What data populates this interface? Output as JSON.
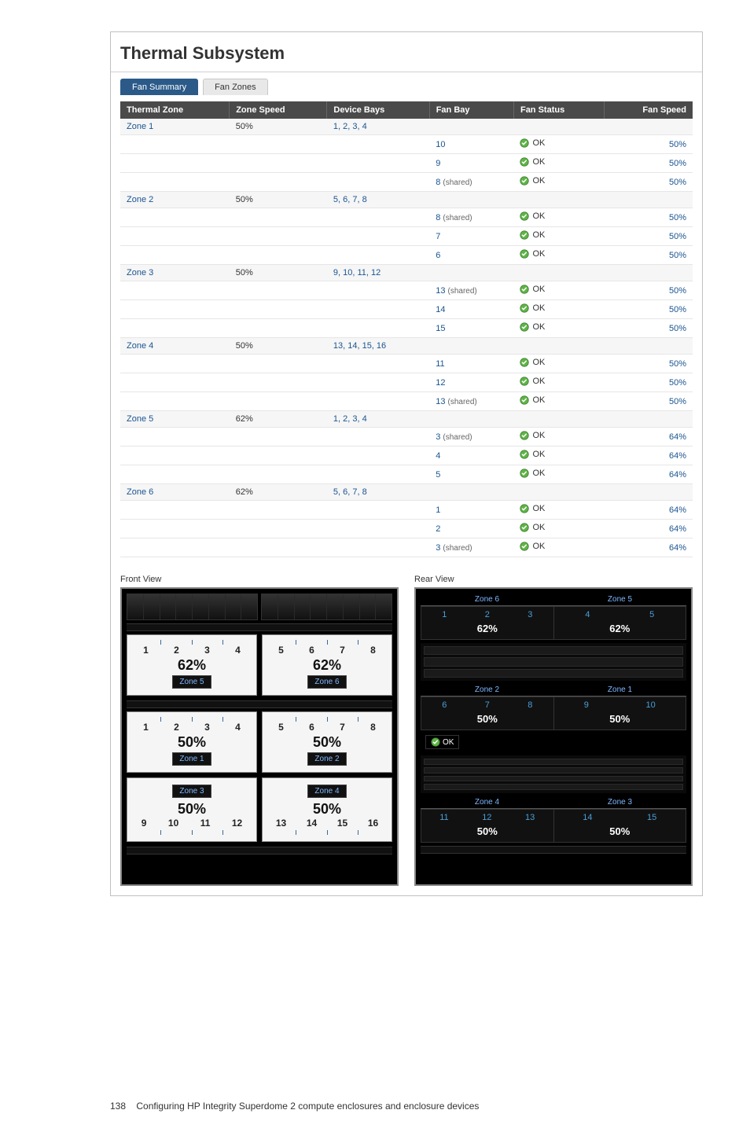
{
  "title": "Thermal Subsystem",
  "tabs": {
    "summary": "Fan Summary",
    "zones": "Fan Zones"
  },
  "columns": {
    "zone": "Thermal Zone",
    "zspeed": "Zone Speed",
    "bays": "Device Bays",
    "fanbay": "Fan Bay",
    "fstatus": "Fan Status",
    "fspeed": "Fan Speed"
  },
  "status_ok": "OK",
  "shared_suffix": "(shared)",
  "zones": [
    {
      "name": "Zone 1",
      "speed": "50%",
      "device_bays": "1, 2, 3, 4",
      "fans": [
        {
          "bay": "10",
          "shared": false,
          "status": "OK",
          "speed": "50%"
        },
        {
          "bay": "9",
          "shared": false,
          "status": "OK",
          "speed": "50%"
        },
        {
          "bay": "8",
          "shared": true,
          "status": "OK",
          "speed": "50%"
        }
      ]
    },
    {
      "name": "Zone 2",
      "speed": "50%",
      "device_bays": "5, 6, 7, 8",
      "fans": [
        {
          "bay": "8",
          "shared": true,
          "status": "OK",
          "speed": "50%"
        },
        {
          "bay": "7",
          "shared": false,
          "status": "OK",
          "speed": "50%"
        },
        {
          "bay": "6",
          "shared": false,
          "status": "OK",
          "speed": "50%"
        }
      ]
    },
    {
      "name": "Zone 3",
      "speed": "50%",
      "device_bays": "9, 10, 11, 12",
      "fans": [
        {
          "bay": "13",
          "shared": true,
          "status": "OK",
          "speed": "50%"
        },
        {
          "bay": "14",
          "shared": false,
          "status": "OK",
          "speed": "50%"
        },
        {
          "bay": "15",
          "shared": false,
          "status": "OK",
          "speed": "50%"
        }
      ]
    },
    {
      "name": "Zone 4",
      "speed": "50%",
      "device_bays": "13, 14, 15, 16",
      "fans": [
        {
          "bay": "11",
          "shared": false,
          "status": "OK",
          "speed": "50%"
        },
        {
          "bay": "12",
          "shared": false,
          "status": "OK",
          "speed": "50%"
        },
        {
          "bay": "13",
          "shared": true,
          "status": "OK",
          "speed": "50%"
        }
      ]
    },
    {
      "name": "Zone 5",
      "speed": "62%",
      "device_bays": "1, 2, 3, 4",
      "fans": [
        {
          "bay": "3",
          "shared": true,
          "status": "OK",
          "speed": "64%"
        },
        {
          "bay": "4",
          "shared": false,
          "status": "OK",
          "speed": "64%"
        },
        {
          "bay": "5",
          "shared": false,
          "status": "OK",
          "speed": "64%"
        }
      ]
    },
    {
      "name": "Zone 6",
      "speed": "62%",
      "device_bays": "5, 6, 7, 8",
      "fans": [
        {
          "bay": "1",
          "shared": false,
          "status": "OK",
          "speed": "64%"
        },
        {
          "bay": "2",
          "shared": false,
          "status": "OK",
          "speed": "64%"
        },
        {
          "bay": "3",
          "shared": true,
          "status": "OK",
          "speed": "64%"
        }
      ]
    }
  ],
  "front_view": {
    "label": "Front View",
    "row1": [
      {
        "bays": [
          "1",
          "2",
          "3",
          "4"
        ],
        "pct": "62%",
        "zone": "Zone 5"
      },
      {
        "bays": [
          "5",
          "6",
          "7",
          "8"
        ],
        "pct": "62%",
        "zone": "Zone 6"
      }
    ],
    "row2": [
      {
        "bays": [
          "1",
          "2",
          "3",
          "4"
        ],
        "pct": "50%",
        "zone": "Zone 1"
      },
      {
        "bays": [
          "5",
          "6",
          "7",
          "8"
        ],
        "pct": "50%",
        "zone": "Zone 2"
      }
    ],
    "row3": [
      {
        "bays": [
          "9",
          "10",
          "11",
          "12"
        ],
        "pct": "50%",
        "zone": "Zone 3"
      },
      {
        "bays": [
          "13",
          "14",
          "15",
          "16"
        ],
        "pct": "50%",
        "zone": "Zone 4"
      }
    ]
  },
  "rear_view": {
    "label": "Rear View",
    "row1": {
      "left_label": "Zone 6",
      "right_label": "Zone 5",
      "left": {
        "bays": [
          "1",
          "2",
          "3"
        ],
        "pct": "62%"
      },
      "right": {
        "bays": [
          "4",
          "5"
        ],
        "pct": "62%"
      }
    },
    "row2": {
      "left_label": "Zone 2",
      "right_label": "Zone 1",
      "left": {
        "bays": [
          "6",
          "7",
          "8"
        ],
        "pct": "50%"
      },
      "right": {
        "bays": [
          "9",
          "10"
        ],
        "pct": "50%"
      },
      "ok": "OK"
    },
    "row3": {
      "left_label": "Zone 4",
      "right_label": "Zone 3",
      "left": {
        "bays": [
          "11",
          "12",
          "13"
        ],
        "pct": "50%"
      },
      "right": {
        "bays": [
          "14",
          "15"
        ],
        "pct": "50%"
      }
    }
  },
  "footer": {
    "page_no": "138",
    "text": "Configuring HP Integrity Superdome 2 compute enclosures and enclosure devices"
  }
}
